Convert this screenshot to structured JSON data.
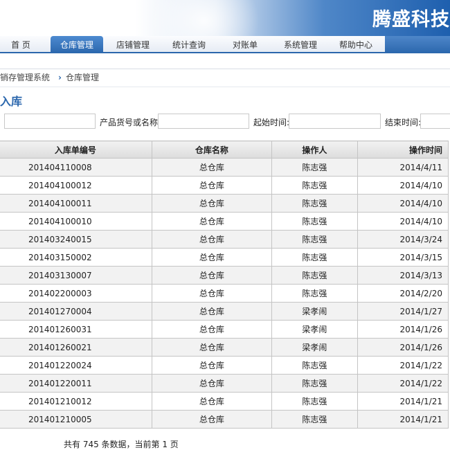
{
  "header": {
    "brand": "腾盛科技"
  },
  "nav": {
    "items": [
      {
        "label": "首 页"
      },
      {
        "label": "仓库管理"
      },
      {
        "label": "店铺管理"
      },
      {
        "label": "统计查询"
      },
      {
        "label": "对账单"
      },
      {
        "label": "系统管理"
      },
      {
        "label": "帮助中心"
      }
    ],
    "active": "仓库管理"
  },
  "breadcrumb": {
    "root": "销存管理系统",
    "current": "仓库管理"
  },
  "page_title": "入库",
  "filters": {
    "product_label": "产品货号或名称:",
    "start_label": "起始时间:",
    "end_label": "结束时间:"
  },
  "table": {
    "columns": [
      "入库单编号",
      "仓库名称",
      "操作人",
      "操作时间"
    ],
    "rows": [
      [
        "201404110008",
        "总仓库",
        "陈志强",
        "2014/4/11"
      ],
      [
        "201404100012",
        "总仓库",
        "陈志强",
        "2014/4/10"
      ],
      [
        "201404100011",
        "总仓库",
        "陈志强",
        "2014/4/10"
      ],
      [
        "201404100010",
        "总仓库",
        "陈志强",
        "2014/4/10"
      ],
      [
        "201403240015",
        "总仓库",
        "陈志强",
        "2014/3/24"
      ],
      [
        "201403150002",
        "总仓库",
        "陈志强",
        "2014/3/15"
      ],
      [
        "201403130007",
        "总仓库",
        "陈志强",
        "2014/3/13"
      ],
      [
        "201402200003",
        "总仓库",
        "陈志强",
        "2014/2/20"
      ],
      [
        "201401270004",
        "总仓库",
        "梁孝闹",
        "2014/1/27"
      ],
      [
        "201401260031",
        "总仓库",
        "梁孝闹",
        "2014/1/26"
      ],
      [
        "201401260021",
        "总仓库",
        "梁孝闹",
        "2014/1/26"
      ],
      [
        "201401220024",
        "总仓库",
        "陈志强",
        "2014/1/22"
      ],
      [
        "201401220011",
        "总仓库",
        "陈志强",
        "2014/1/22"
      ],
      [
        "201401210012",
        "总仓库",
        "陈志强",
        "2014/1/21"
      ],
      [
        "201401210005",
        "总仓库",
        "陈志强",
        "2014/1/21"
      ]
    ]
  },
  "footer": {
    "summary": "共有 745 条数据，当前第 1 页"
  }
}
